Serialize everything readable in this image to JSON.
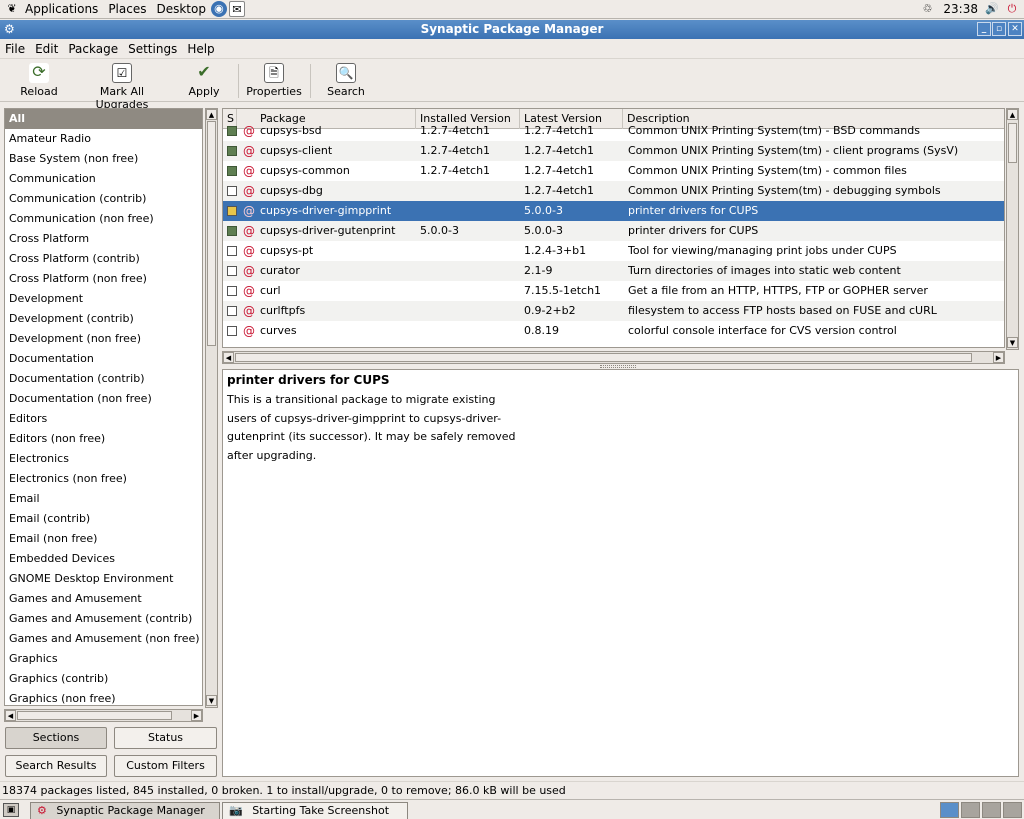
{
  "top_panel": {
    "menus": [
      "Applications",
      "Places",
      "Desktop"
    ],
    "clock": "23:38"
  },
  "window": {
    "title": "Synaptic Package Manager"
  },
  "menubar": [
    "File",
    "Edit",
    "Package",
    "Settings",
    "Help"
  ],
  "toolbar": {
    "reload": "Reload",
    "mark_all": "Mark All Upgrades",
    "apply": "Apply",
    "properties": "Properties",
    "search": "Search"
  },
  "sections": [
    "All",
    "Amateur Radio",
    "Base System (non free)",
    "Communication",
    "Communication (contrib)",
    "Communication (non free)",
    "Cross Platform",
    "Cross Platform (contrib)",
    "Cross Platform (non free)",
    "Development",
    "Development (contrib)",
    "Development (non free)",
    "Documentation",
    "Documentation (contrib)",
    "Documentation (non free)",
    "Editors",
    "Editors (non free)",
    "Electronics",
    "Electronics (non free)",
    "Email",
    "Email (contrib)",
    "Email (non free)",
    "Embedded Devices",
    "GNOME Desktop Environment",
    "Games and Amusement",
    "Games and Amusement (contrib)",
    "Games and Amusement (non free)",
    "Graphics",
    "Graphics (contrib)",
    "Graphics (non free)"
  ],
  "selected_section": "All",
  "filter_buttons": {
    "sections": "Sections",
    "status": "Status",
    "search_results": "Search Results",
    "custom_filters": "Custom Filters"
  },
  "table": {
    "columns": [
      "S",
      "Package",
      "Installed Version",
      "Latest Version",
      "Description"
    ],
    "rows": [
      {
        "status": "installed",
        "package": "cupsys-bsd",
        "installed": "1.2.7-4etch1",
        "latest": "1.2.7-4etch1",
        "description": "Common UNIX Printing System(tm) - BSD commands"
      },
      {
        "status": "installed",
        "package": "cupsys-client",
        "installed": "1.2.7-4etch1",
        "latest": "1.2.7-4etch1",
        "description": "Common UNIX Printing System(tm) - client programs (SysV)"
      },
      {
        "status": "installed",
        "package": "cupsys-common",
        "installed": "1.2.7-4etch1",
        "latest": "1.2.7-4etch1",
        "description": "Common UNIX Printing System(tm) - common files"
      },
      {
        "status": "not-installed",
        "package": "cupsys-dbg",
        "installed": "",
        "latest": "1.2.7-4etch1",
        "description": "Common UNIX Printing System(tm) - debugging symbols"
      },
      {
        "status": "install",
        "package": "cupsys-driver-gimpprint",
        "installed": "",
        "latest": "5.0.0-3",
        "description": "printer drivers for CUPS",
        "selected": true
      },
      {
        "status": "installed",
        "package": "cupsys-driver-gutenprint",
        "installed": "5.0.0-3",
        "latest": "5.0.0-3",
        "description": "printer drivers for CUPS"
      },
      {
        "status": "not-installed",
        "package": "cupsys-pt",
        "installed": "",
        "latest": "1.2.4-3+b1",
        "description": "Tool for viewing/managing print jobs under CUPS"
      },
      {
        "status": "not-installed",
        "package": "curator",
        "installed": "",
        "latest": "2.1-9",
        "description": "Turn directories of images into static web content"
      },
      {
        "status": "not-installed",
        "package": "curl",
        "installed": "",
        "latest": "7.15.5-1etch1",
        "description": "Get a file from an HTTP, HTTPS, FTP or GOPHER server"
      },
      {
        "status": "not-installed",
        "package": "curlftpfs",
        "installed": "",
        "latest": "0.9-2+b2",
        "description": "filesystem to access FTP hosts based on FUSE and cURL"
      },
      {
        "status": "not-installed",
        "package": "curves",
        "installed": "",
        "latest": "0.8.19",
        "description": "colorful console interface for CVS version control"
      }
    ]
  },
  "description_panel": {
    "title": "printer drivers for CUPS",
    "body": "This is a transitional package to migrate existing users of cupsys-driver-gimpprint to cupsys-driver-gutenprint (its successor).  It may be safely removed after upgrading."
  },
  "status_bar": "18374 packages listed, 845 installed, 0 broken. 1 to install/upgrade, 0 to remove; 86.0 kB will be used",
  "taskbar": {
    "tasks": [
      "Synaptic Package Manager",
      "Starting Take Screenshot"
    ]
  },
  "colors": {
    "title_bar": "#3b72b3",
    "selection": "#3b72b3",
    "installed_box": "#5f7f52",
    "debian_swirl": "#c8102e"
  }
}
